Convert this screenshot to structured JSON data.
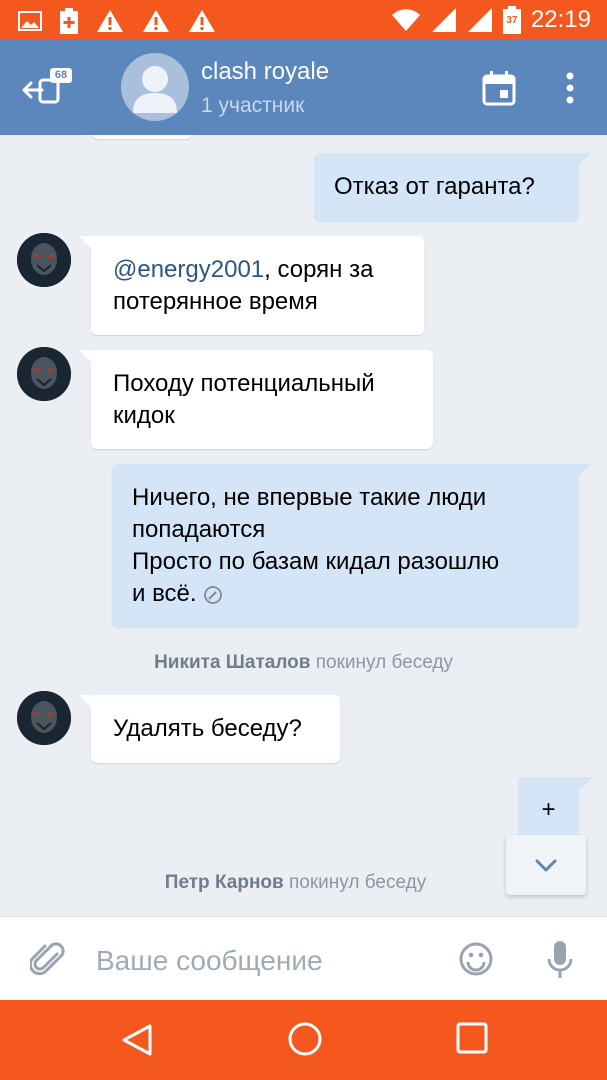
{
  "status_bar": {
    "time": "22:19",
    "battery_level": "37",
    "icons": [
      "image-icon",
      "battery-plus-icon",
      "warning-icon",
      "warning-icon",
      "warning-icon",
      "wifi-icon",
      "signal-icon",
      "signal-icon",
      "battery-icon"
    ]
  },
  "header": {
    "title": "clash royale",
    "subtitle": "1 участник",
    "badge": "68"
  },
  "messages": [
    {
      "type": "out",
      "text": "Отказ от гаранта?"
    },
    {
      "type": "in",
      "mention": "@energy2001",
      "text_line1": ", сорян за",
      "text_line2": "потерянное время"
    },
    {
      "type": "in",
      "text_line1": "Походу потенциальный",
      "text_line2": "кидок"
    },
    {
      "type": "out",
      "text_line1": "Ничего, не впервые такие люди",
      "text_line2": "попадаются",
      "text_line3": "Просто по базам кидал разошлю",
      "text_line4": "и всё."
    },
    {
      "type": "system",
      "name": "Никита Шаталов",
      "action": " покинул беседу"
    },
    {
      "type": "in",
      "text": "Удалять беседу?"
    },
    {
      "type": "out",
      "text": "+"
    },
    {
      "type": "system",
      "name": "Петр Карнов",
      "action": " покинул беседу"
    }
  ],
  "input": {
    "placeholder": "Ваше сообщение",
    "value": ""
  },
  "colors": {
    "status_bar": "#f5581e",
    "header": "#5b87bd",
    "chat_bg": "#ebeef2",
    "bubble_out": "#d5e5f8",
    "bubble_in": "#ffffff",
    "mention": "#2a5885"
  }
}
